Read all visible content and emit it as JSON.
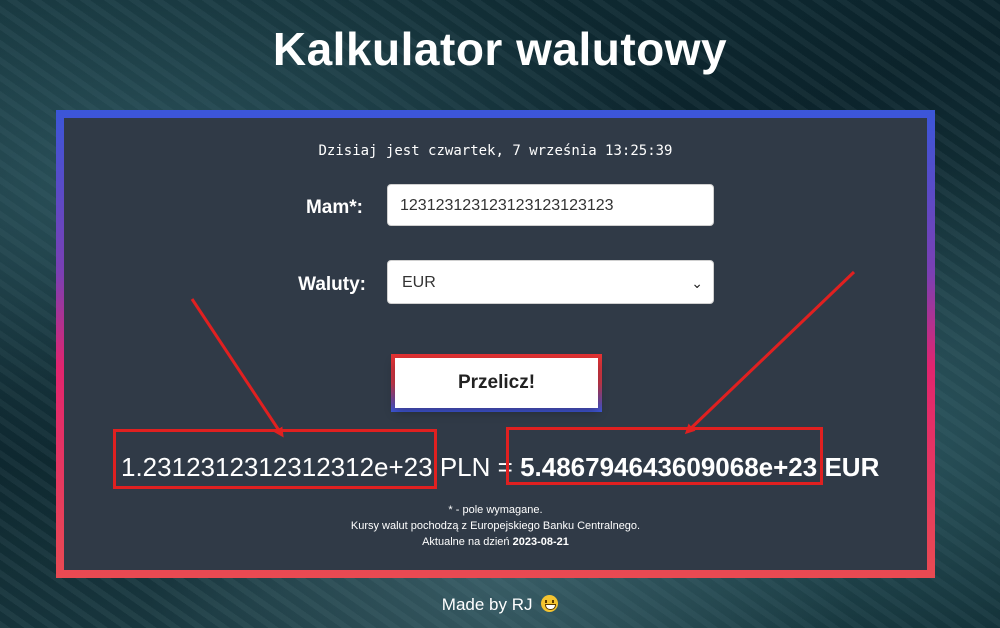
{
  "page": {
    "title": "Kalkulator walutowy"
  },
  "card": {
    "date_line": "Dzisiaj jest czwartek, 7 września 13:25:39",
    "amount_label": "Mam*:",
    "amount_value": "123123123123123123123123",
    "currency_label": "Waluty:",
    "currency_selected": "EUR",
    "convert_button": "Przelicz!",
    "result": {
      "input_amount": "1.2312312312312312e+23",
      "input_currency": "PLN",
      "equals": "=",
      "output_amount": "5.486794643609068e+23",
      "output_currency": "EUR"
    },
    "notes": {
      "required": "* - pole wymagane.",
      "source": "Kursy walut pochodzą z Europejskiego Banku Centralnego.",
      "updated_prefix": "Aktualne na dzień",
      "updated_date": "2023-08-21"
    }
  },
  "footer": {
    "text": "Made by RJ"
  },
  "colors": {
    "card_bg": "#303a47",
    "border_top": "#3b56d9",
    "border_bottom": "#e94a52",
    "annotation": "#e02020"
  }
}
